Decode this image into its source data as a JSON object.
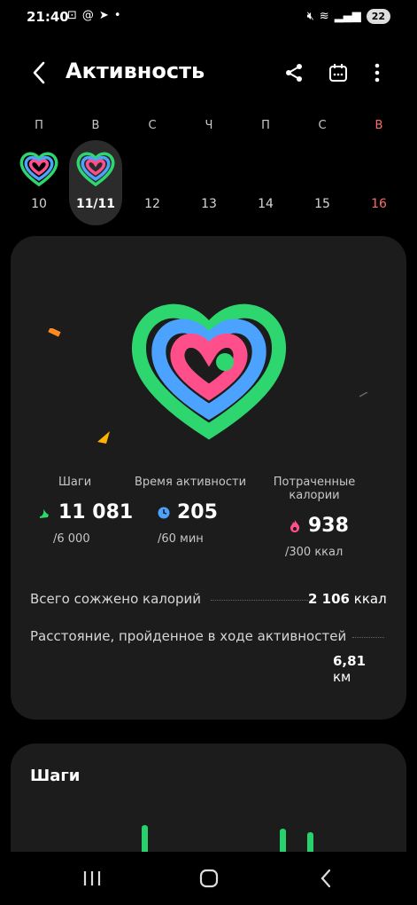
{
  "status_bar": {
    "time": "21:40",
    "battery": "22"
  },
  "header": {
    "title": "Активность"
  },
  "week": [
    {
      "letter": "П",
      "num": "10"
    },
    {
      "letter": "В",
      "num": "11/11"
    },
    {
      "letter": "С",
      "num": "12"
    },
    {
      "letter": "Ч",
      "num": "13"
    },
    {
      "letter": "П",
      "num": "14"
    },
    {
      "letter": "С",
      "num": "15"
    },
    {
      "letter": "В",
      "num": "16"
    }
  ],
  "stats": {
    "steps": {
      "label": "Шаги",
      "value": "11 081",
      "goal": "/6 000"
    },
    "active_time": {
      "label": "Время активности",
      "value": "205",
      "goal": "/60 мин"
    },
    "calories": {
      "label": "Потраченные калории",
      "value": "938",
      "goal": "/300 ккал"
    }
  },
  "total_calories": {
    "label": "Всего сожжено калорий",
    "value": "2 106",
    "unit": "ккал"
  },
  "distance": {
    "label": "Расстояние, пройденное в ходе активностей",
    "value": "6,81",
    "unit": "км"
  },
  "steps_card": {
    "title": "Шаги"
  },
  "colors": {
    "steps": "#2ed66f",
    "active": "#4ba3ff",
    "calories": "#ff4f8b",
    "sunday": "#ff6b6b",
    "card": "#1c1c1c"
  },
  "icons": [
    "back-icon",
    "share-icon",
    "calendar-icon",
    "more-icon",
    "steps-icon",
    "clock-icon",
    "flame-icon"
  ]
}
